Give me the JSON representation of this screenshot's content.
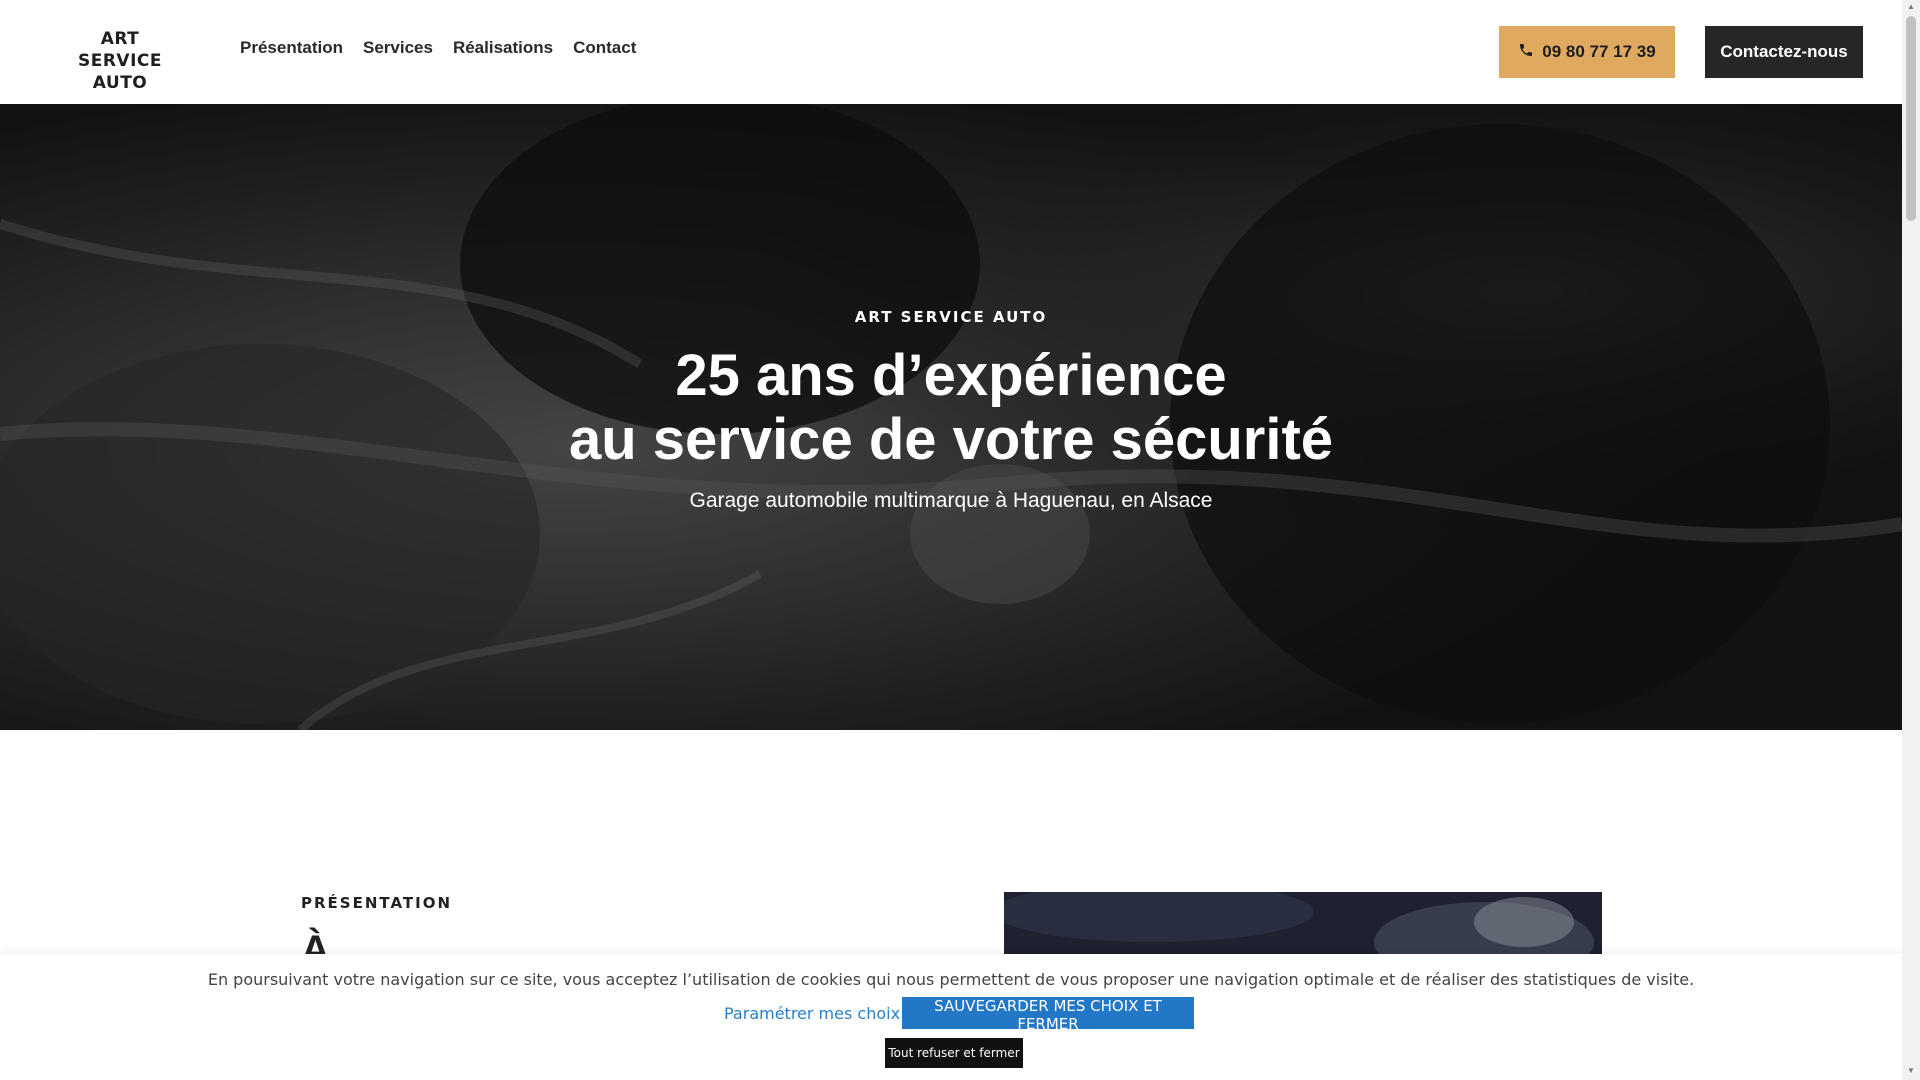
{
  "header": {
    "logo_line1": "ART SERVICE",
    "logo_line2": "AUTO",
    "nav": [
      "Présentation",
      "Services",
      "Réalisations",
      "Contact"
    ],
    "phone_label": "09 80 77 17 39",
    "contact_label": "Contactez-nous",
    "accent_color": "#e0a960",
    "dark_color": "#262626"
  },
  "hero": {
    "eyebrow": "ART SERVICE AUTO",
    "title_line1": "25 ans d’expérience",
    "title_line2": "au service de votre sécurité",
    "subtitle": "Garage automobile multimarque à Haguenau, en Alsace"
  },
  "presentation": {
    "eyebrow": "PRÉSENTATION",
    "heading_fragment": "À"
  },
  "cookie_banner": {
    "text": "En poursuivant votre navigation sur ce site, vous acceptez l’utilisation de cookies qui nous permettent de vous proposer une navigation optimale et de réaliser des statistiques de visite.",
    "settings_link": "Paramétrer mes choix",
    "save_button": "SAUVEGARDER MES CHOIX ET FERMER",
    "refuse_button": "Tout refuser et fermer",
    "save_color": "#2277c6",
    "link_color": "#2a80c7"
  },
  "icons": [
    "phone-icon"
  ]
}
